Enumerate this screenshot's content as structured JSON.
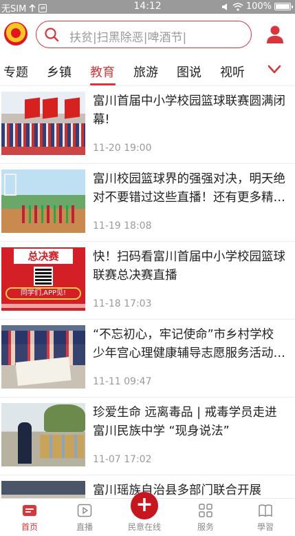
{
  "status_bar": {
    "carrier": "无SIM",
    "time": "14:12",
    "battery": "100%"
  },
  "header": {
    "search_placeholder": "扶贫|扫黑除恶|啤酒节|"
  },
  "tabs": {
    "items": [
      "专题",
      "乡镇",
      "教育",
      "旅游",
      "图说",
      "视听"
    ],
    "active_index": 2
  },
  "articles": [
    {
      "title": "富川首届中小学校园篮球联赛圆满闭幕!",
      "time": "11-20 19:00"
    },
    {
      "title": "富川校园篮球界的强强对决，明天绝对不要错过这些直播！还有更多精彩内容等你来看",
      "time": "11-19 18:08"
    },
    {
      "title": "快！扫码看富川首届中小学校园篮球联赛总决赛直播",
      "time": "11-18 17:03",
      "thumb_text": {
        "banner": "总决赛",
        "slogan": "同学们,APP见!"
      }
    },
    {
      "title": "“不忘初心，牢记使命”市乡村学校少年宫心理健康辅导志愿服务活动走进富川",
      "time": "11-11 09:47"
    },
    {
      "title": "珍爱生命 远离毒品 | 戒毒学员走进富川民族中学 “现身说法”",
      "time": "11-07 17:02"
    },
    {
      "title": "富川瑶族自治县多部门联合开展",
      "time": ""
    }
  ],
  "bottom_nav": [
    {
      "label": "首页",
      "icon": "home-icon",
      "active": true
    },
    {
      "label": "直播",
      "icon": "play-icon",
      "active": false
    },
    {
      "label": "民意在线",
      "icon": "plus-icon",
      "active": false,
      "center_symbol": "+"
    },
    {
      "label": "服务",
      "icon": "grid-icon",
      "active": false
    },
    {
      "label": "學習",
      "icon": "book-icon",
      "active": false
    }
  ],
  "colors": {
    "accent": "#d9353a",
    "status_bar": "#9a9a9a",
    "text_secondary": "#9a9a9a"
  }
}
